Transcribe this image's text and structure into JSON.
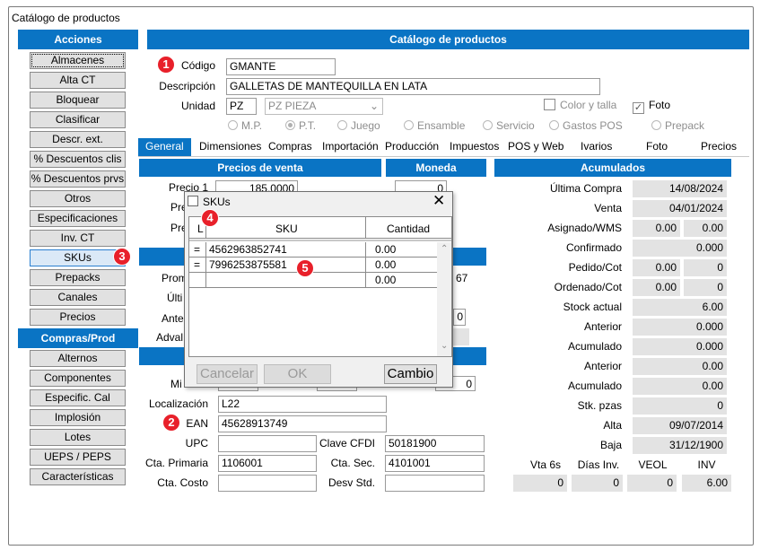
{
  "window": {
    "title": "Catálogo de productos"
  },
  "sidebar": {
    "acciones_header": "Acciones",
    "acciones": [
      "Almacenes",
      "Alta CT",
      "Bloquear",
      "Clasificar",
      "Descr. ext.",
      "% Descuentos clis",
      "% Descuentos prvs",
      "Otros",
      "Especificaciones",
      "Inv. CT",
      "SKUs",
      "Prepacks",
      "Canales",
      "Precios"
    ],
    "compras_header": "Compras/Prod",
    "compras": [
      "Alternos",
      "Componentes",
      "Especific. Cal",
      "Implosión",
      "Lotes",
      "UEPS / PEPS",
      "Características"
    ]
  },
  "main": {
    "header": "Catálogo de productos",
    "codigo_label": "Código",
    "codigo": "GMANTE",
    "descripcion_label": "Descripción",
    "descripcion": "GALLETAS  DE MANTEQUILLA EN LATA",
    "unidad_label": "Unidad",
    "unidad": "PZ",
    "unidad_desc": "PZ  PIEZA",
    "color_talla": "Color y talla",
    "foto_chk": "Foto",
    "radios": [
      "M.P.",
      "P.T.",
      "Juego",
      "Ensamble",
      "Servicio",
      "Gastos POS",
      "Prepack"
    ]
  },
  "tabs": [
    "General",
    "Dimensiones",
    "Compras",
    "Importación",
    "Producción",
    "Impuestos",
    "POS y Web",
    "Ivarios",
    "Foto",
    "Precios"
  ],
  "precios": {
    "header": "Precios de venta",
    "precio1_label": "Precio 1",
    "precio1": "185.0000",
    "pre2_label": "Pre",
    "pre3_label": "Pre",
    "prom_label": "Prom",
    "ult_label": "Últi",
    "ante_label": "Ante",
    "adval_label": "Adval",
    "min_label": "Mi",
    "partial_67": "67",
    "partial_0a": "0",
    "partial_0b": "0"
  },
  "moneda": {
    "header": "Moneda",
    "value": "0"
  },
  "detalle": {
    "localizacion_label": "Localización",
    "localizacion": "L22",
    "ean_label": "EAN",
    "ean": "45628913749",
    "upc_label": "UPC",
    "upc": "",
    "cfdi_label": "Clave CFDI",
    "cfdi": "50181900",
    "cta_primaria_label": "Cta. Primaria",
    "cta_primaria": "1106001",
    "cta_sec_label": "Cta. Sec.",
    "cta_sec": "4101001",
    "cta_costo_label": "Cta. Costo",
    "cta_costo": "",
    "desv_label": "Desv Std.",
    "desv": ""
  },
  "acumulados": {
    "header": "Acumulados",
    "ultima_compra_label": "Última  Compra",
    "ultima_compra": "14/08/2024",
    "venta_label": "Venta",
    "venta": "04/01/2024",
    "asignado_label": "Asignado/WMS",
    "asignado_a": "0.00",
    "asignado_b": "0.00",
    "confirmado_label": "Confirmado",
    "confirmado": "0.000",
    "pedido_label": "Pedido/Cot",
    "pedido_a": "0.00",
    "pedido_b": "0",
    "ordenado_label": "Ordenado/Cot",
    "ordenado_a": "0.00",
    "ordenado_b": "0",
    "stock_label": "Stock actual",
    "stock": "6.00",
    "anterior1_label": "Anterior",
    "anterior1": "0.000",
    "acumulado1_label": "Acumulado",
    "acumulado1": "0.000",
    "anterior2_label": "Anterior",
    "anterior2": "0.00",
    "acumulado2_label": "Acumulado",
    "acumulado2": "0.00",
    "stk_label": "Stk. pzas",
    "stk": "0",
    "alta_label": "Alta",
    "alta": "09/07/2014",
    "baja_label": "Baja",
    "baja": "31/12/1900",
    "bottom_labels": [
      "Vta 6s",
      "Días Inv.",
      "VEOL",
      "INV"
    ],
    "bottom_values": [
      "0",
      "0",
      "0",
      "6.00"
    ]
  },
  "dialog": {
    "title": "SKUs",
    "col_l": "L",
    "col_sku": "SKU",
    "col_cant": "Cantidad",
    "rows": [
      {
        "mark": "=",
        "sku": "4562963852741",
        "cant": "0.00"
      },
      {
        "mark": "=",
        "sku": "7996253875581",
        "cant": "0.00"
      },
      {
        "mark": "",
        "sku": "",
        "cant": "0.00"
      }
    ],
    "cancelar": "Cancelar",
    "ok": "OK",
    "cambio": "Cambio"
  },
  "badges": [
    "1",
    "2",
    "3",
    "4",
    "5"
  ],
  "colors": {
    "header_blue": "#0a74c4",
    "badge_red": "#e8202a"
  }
}
